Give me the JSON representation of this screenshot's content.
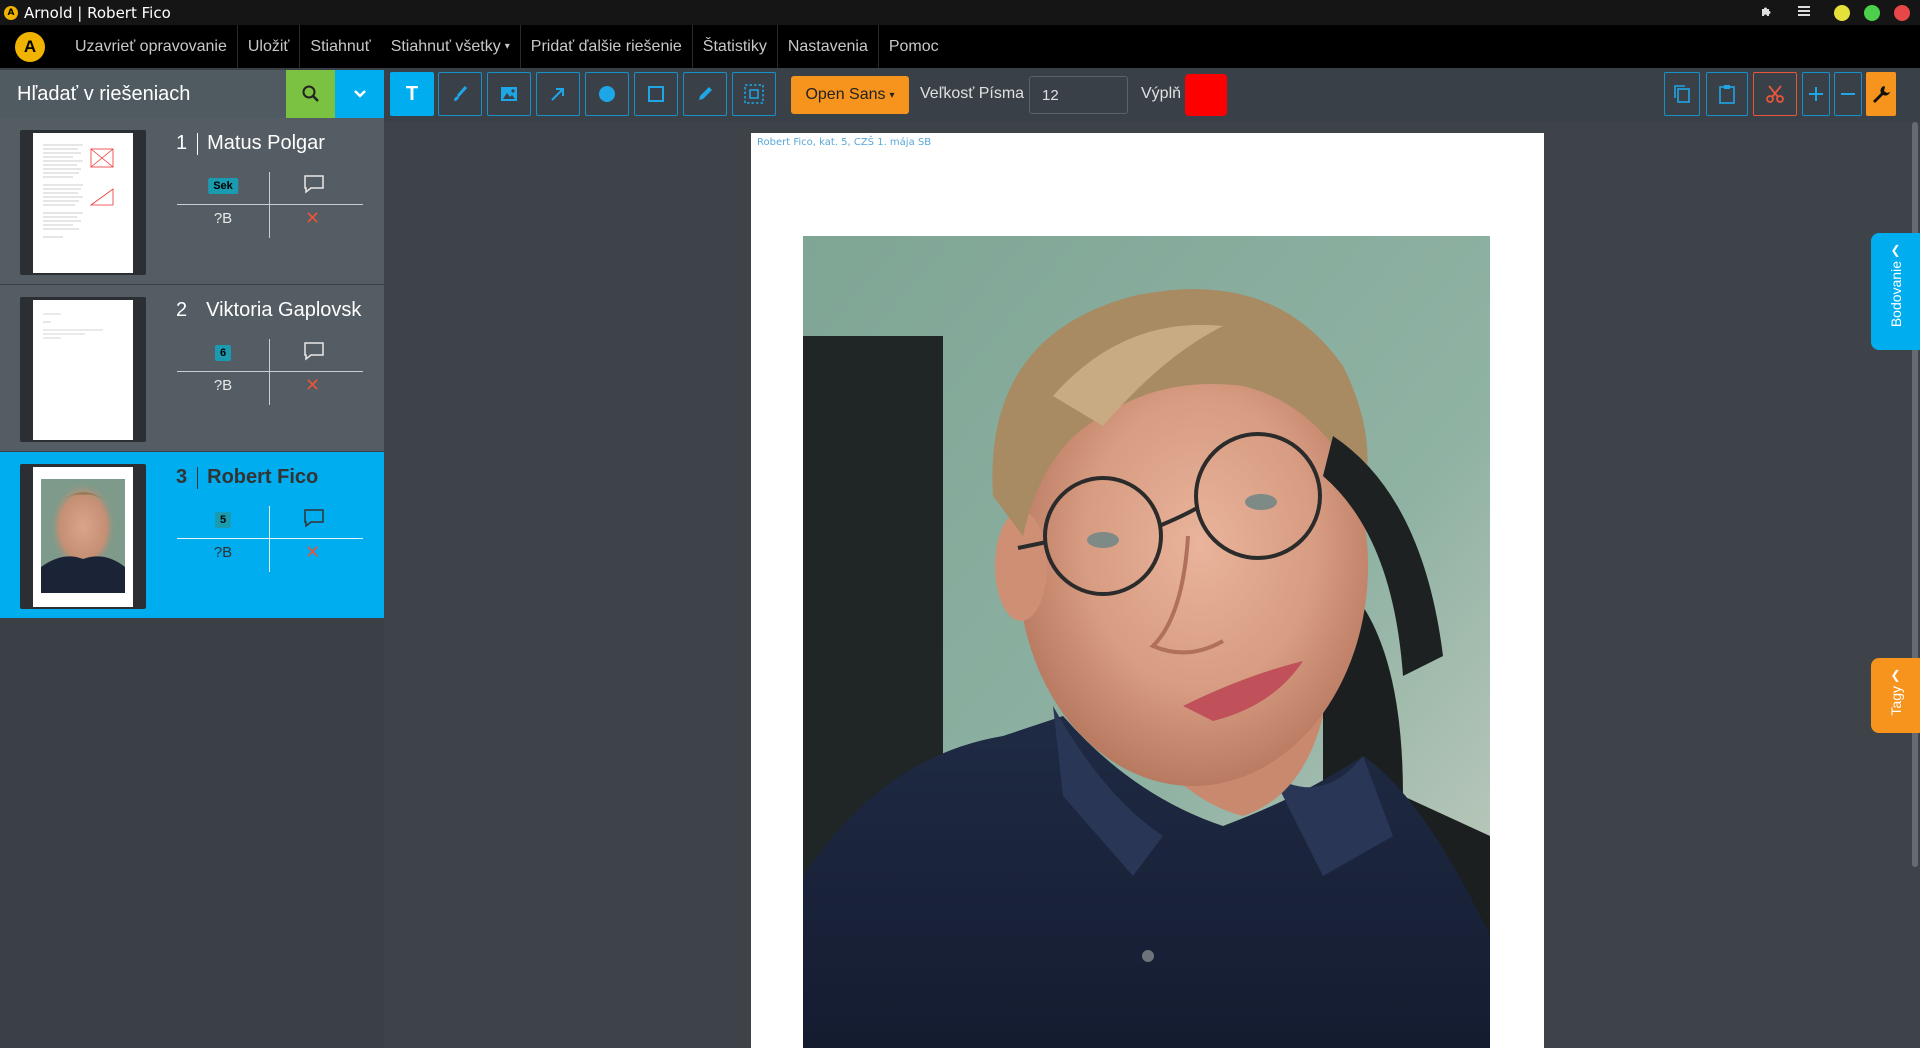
{
  "window": {
    "title": "Arnold | Robert Fico",
    "app_icon_letter": "A"
  },
  "menu": {
    "logo_letter": "A",
    "items": [
      {
        "label": "Uzavrieť opravovanie"
      },
      {
        "label": "Uložiť"
      },
      {
        "label": "Stiahnuť"
      },
      {
        "label": "Stiahnuť všetky",
        "has_dropdown": true
      },
      {
        "label": "Pridať ďalšie riešenie"
      },
      {
        "label": "Štatistiky"
      },
      {
        "label": "Nastavenia"
      },
      {
        "label": "Pomoc"
      }
    ]
  },
  "sidebar": {
    "search_placeholder": "Hľadať v riešeniach",
    "entries": [
      {
        "number": "1",
        "name": "Matus Polgar",
        "badge": "Sek",
        "score": "?B",
        "active": false
      },
      {
        "number": "2",
        "name": "Viktoria Gaplovská",
        "badge": "6",
        "score": "?B",
        "active": false
      },
      {
        "number": "3",
        "name": "Robert Fico",
        "badge": "5",
        "score": "?B",
        "active": true
      }
    ]
  },
  "toolbar": {
    "tools": [
      "text-tool",
      "brush-tool",
      "image-tool",
      "arrow-tool",
      "circle-tool",
      "rectangle-tool",
      "pencil-tool",
      "select-tool"
    ],
    "active_tool": "text-tool",
    "font_family": "Open Sans",
    "font_size_label": "Veľkosť Písma",
    "font_size_value": "12",
    "fill_label": "Výplň",
    "fill_color": "#ff0000",
    "right_tools": [
      "copy-tool",
      "paste-tool",
      "cut-tool",
      "zoom-in-tool",
      "zoom-out-tool",
      "settings-tool"
    ]
  },
  "document": {
    "header_text": "Robert Fico, kat. 5, CZŠ 1. mája SB"
  },
  "side_tabs": {
    "scoring": "Bodovanie",
    "tags": "Tagy"
  },
  "colors": {
    "accent": "#00adee",
    "search_green": "#7cc242",
    "orange": "#f7941d",
    "delete_red": "#e8553b"
  }
}
